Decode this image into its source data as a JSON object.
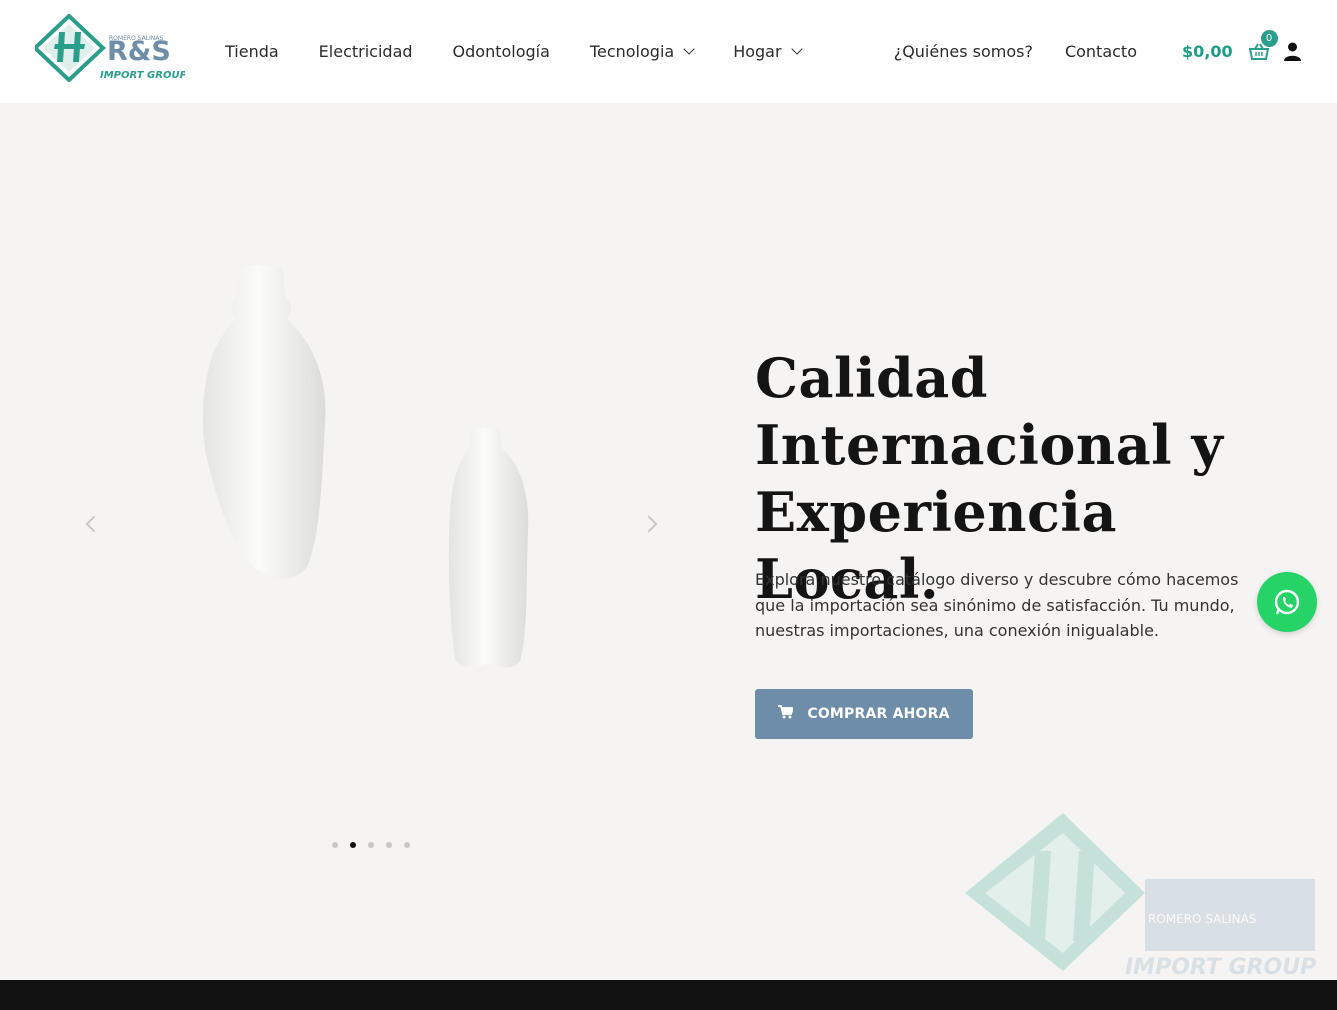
{
  "brand": {
    "logo_mark": "R&S",
    "logo_small": "ROMERO SALINAS",
    "logo_tagline": "IMPORT GROUP",
    "colors": {
      "teal": "#2b9d8b",
      "steel": "#6d8da8",
      "whatsapp": "#25d366"
    }
  },
  "nav": {
    "items": [
      {
        "label": "Tienda",
        "icon": ""
      },
      {
        "label": "Electricidad",
        "icon": ""
      },
      {
        "label": "Odontología",
        "icon": ""
      },
      {
        "label": "Tecnologia",
        "icon": "chevron-down-icon"
      },
      {
        "label": "Hogar",
        "icon": "chevron-down-icon"
      }
    ],
    "right_items": [
      {
        "label": "¿Quiénes somos?"
      },
      {
        "label": "Contacto"
      }
    ]
  },
  "cart": {
    "amount": "$0,00",
    "count": "0",
    "icon": "basket-icon"
  },
  "account": {
    "icon": "user-icon"
  },
  "hero": {
    "headline": "Calidad Internacional y Experiencia Local.",
    "description": "Explora nuestro catálogo diverso y descubre cómo hacemos que la importación sea sinónimo de satisfacción. Tu mundo, nuestras importaciones, una conexión inigualable.",
    "cta_label": "COMPRAR AHORA",
    "cta_icon": "cart-icon",
    "slider": {
      "total_slides": 5,
      "active_slide": 2
    }
  },
  "floating": {
    "icon": "whatsapp-icon"
  }
}
